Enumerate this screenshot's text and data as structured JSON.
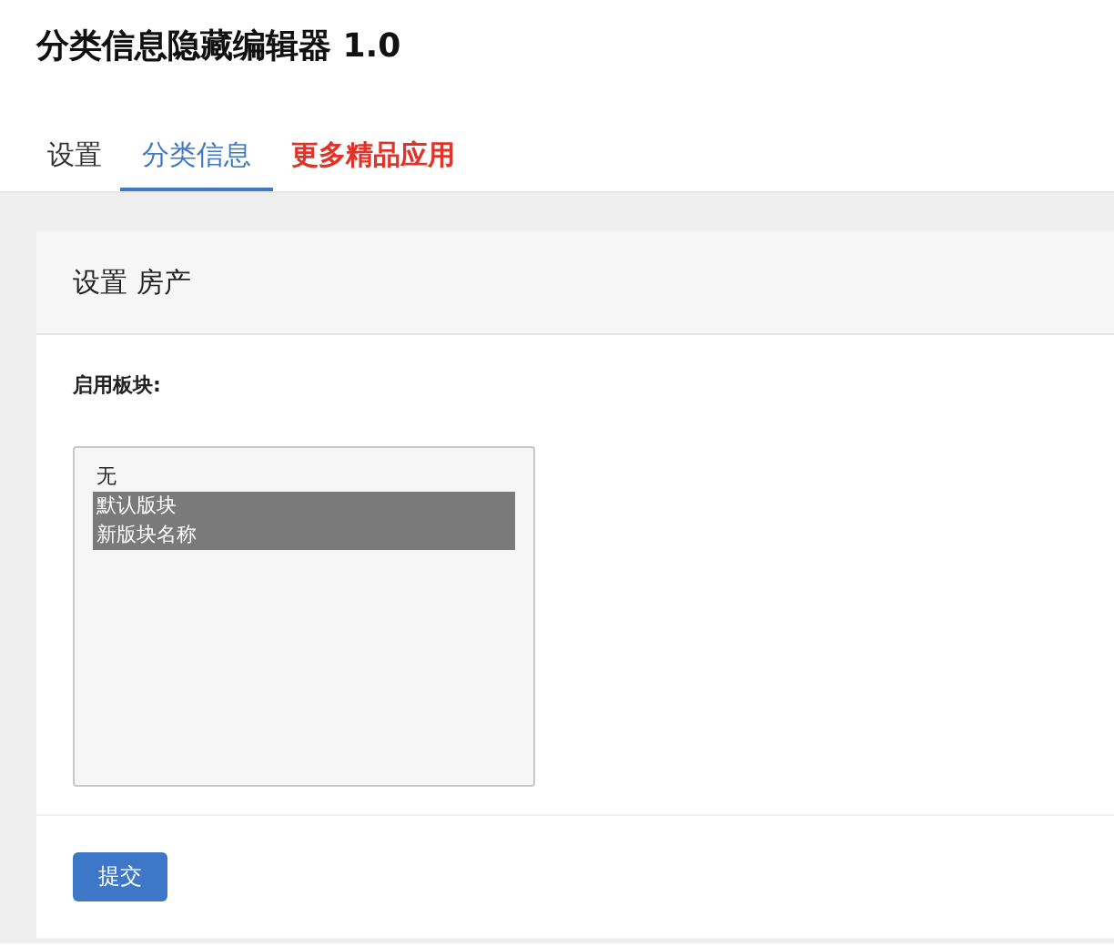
{
  "title": "分类信息隐藏编辑器 1.0",
  "tabs": [
    {
      "label": "设置",
      "kind": "tab",
      "selected": false
    },
    {
      "label": "分类信息",
      "kind": "tab",
      "selected": true
    },
    {
      "label": "更多精品应用",
      "kind": "promo",
      "selected": false
    }
  ],
  "card": {
    "heading": "设置 房产",
    "field_label": "启用板块:",
    "options": [
      {
        "label": "无",
        "selected": false
      },
      {
        "label": "默认版块",
        "selected": true
      },
      {
        "label": "新版块名称",
        "selected": true
      }
    ],
    "submit": "提交"
  }
}
